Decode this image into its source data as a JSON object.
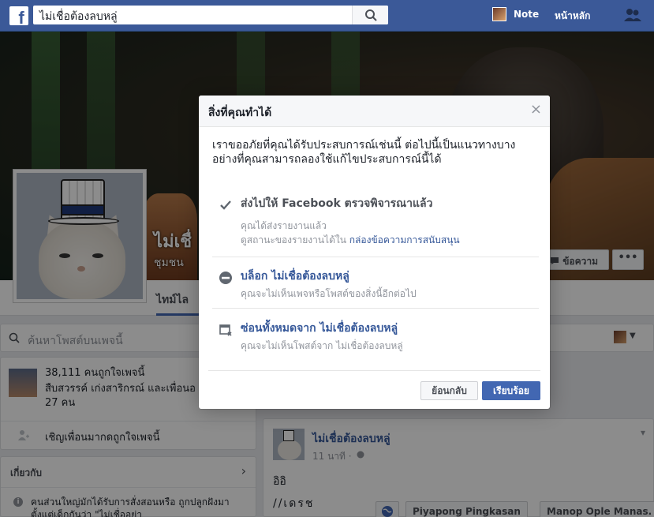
{
  "topbar": {
    "logo": "f",
    "search_value": "ไม่เชื่อต้องลบหลู่",
    "user_name": "Note",
    "home_label": "หน้าหลัก"
  },
  "cover": {
    "page_title": "ไม่เชื่",
    "page_category": "ชุมชน",
    "message_button": "ข้อความ",
    "more_button": "•••"
  },
  "timeline": {
    "tab_label": "ไทม์ไล"
  },
  "left": {
    "search_posts_placeholder": "ค้นหาโพสต์บนเพจนี้",
    "likes_count": "38,111 คนถูกใจเพจนี้",
    "likes_friends": "สืบสวรรค์ เก่งสาริกรณ์ และเพื่อนอ",
    "likes_people": "27 คน",
    "invite_label": "เชิญเพื่อนมากดถูกใจเพจนี้",
    "about_title": "เกี่ยวกับ",
    "about_text": "คนส่วนใหญ่มักได้รับการสั่งสอนหรือ ถูกปลูกฝังมาตั้งแต่เด็กกันว่า \"ไม่เชื่ออย่า"
  },
  "post": {
    "author": "ไม่เชื่อต้องลบหลู่",
    "time": "11 นาที ·",
    "body_line1": "อิอิ",
    "body_line2": "//เดรช",
    "tagged": [
      "Piyapong Pingkasan",
      "Manop Ople Manas."
    ]
  },
  "modal": {
    "title": "สิ่งที่คุณทำได้",
    "close": "×",
    "intro": "เราขออภัยที่คุณได้รับประสบการณ์เช่นนี้ ต่อไปนี้เป็นแนวทางบางอย่างที่คุณสามารถลองใช้แก้ไขประสบการณ์นี้ได้",
    "options": [
      {
        "title": "ส่งไปให้ Facebook ตรวจพิจารณาแล้ว",
        "sub1": "คุณได้ส่งรายงานแล้ว",
        "sub2_prefix": "ดูสถานะของรายงานได้ใน ",
        "sub2_link": "กล่องข้อความการสนับสนุน",
        "icon": "checkmark-icon"
      },
      {
        "title": "บล็อก ไม่เชื่อต้องลบหลู่",
        "sub1": "คุณจะไม่เห็นเพจหรือโพสต์ของสิ่งนี้อีกต่อไป",
        "icon": "block-icon"
      },
      {
        "title": "ซ่อนทั้งหมดจาก ไม่เชื่อต้องลบหลู่",
        "sub1": "คุณจะไม่เห็นโพสต์จาก ไม่เชื่อต้องลบหลู่",
        "icon": "hide-icon"
      }
    ],
    "back_button": "ย้อนกลับ",
    "done_button": "เรียบร้อย"
  },
  "colors": {
    "brand": "#3b5998",
    "button_primary": "#4267b2",
    "link": "#365899"
  }
}
